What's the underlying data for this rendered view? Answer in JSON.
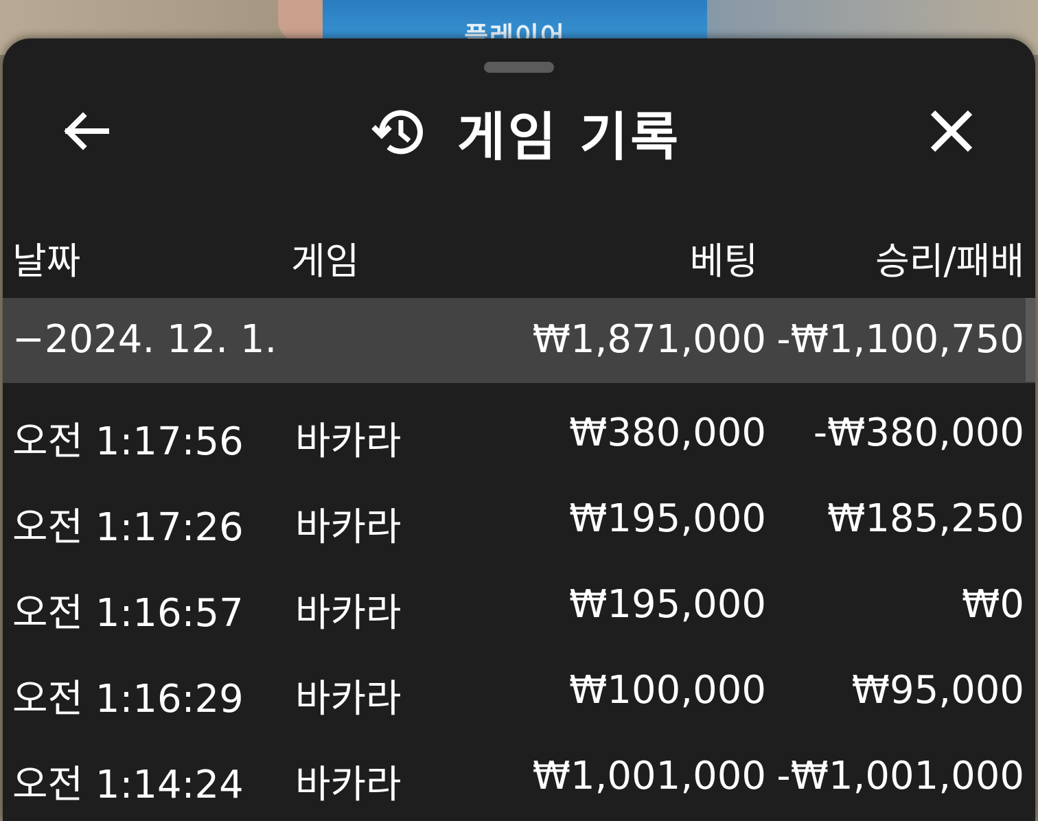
{
  "backdrop": {
    "player_label": "플레이어"
  },
  "header": {
    "title": "게임 기록",
    "back_icon": "arrow-left-icon",
    "history_icon": "history-icon",
    "close_icon": "close-icon"
  },
  "columns": {
    "date": "날짜",
    "game": "게임",
    "bet": "베팅",
    "win_loss": "승리/패배"
  },
  "group": {
    "date": "−2024. 12. 1.",
    "bet": "₩1,871,000",
    "win_loss": "-₩1,100,750"
  },
  "rows": [
    {
      "time": "오전 1:17:56",
      "game": "바카라",
      "bet": "₩380,000",
      "win_loss": "-₩380,000"
    },
    {
      "time": "오전 1:17:26",
      "game": "바카라",
      "bet": "₩195,000",
      "win_loss": "₩185,250"
    },
    {
      "time": "오전 1:16:57",
      "game": "바카라",
      "bet": "₩195,000",
      "win_loss": "₩0"
    },
    {
      "time": "오전 1:16:29",
      "game": "바카라",
      "bet": "₩100,000",
      "win_loss": "₩95,000"
    },
    {
      "time": "오전 1:14:24",
      "game": "바카라",
      "bet": "₩1,001,000",
      "win_loss": "-₩1,001,000"
    }
  ],
  "colors": {
    "sheet_bg": "#1e1e1e",
    "group_row_bg": "#434343",
    "text": "#ffffff",
    "accent_blue": "#3c97d6"
  }
}
